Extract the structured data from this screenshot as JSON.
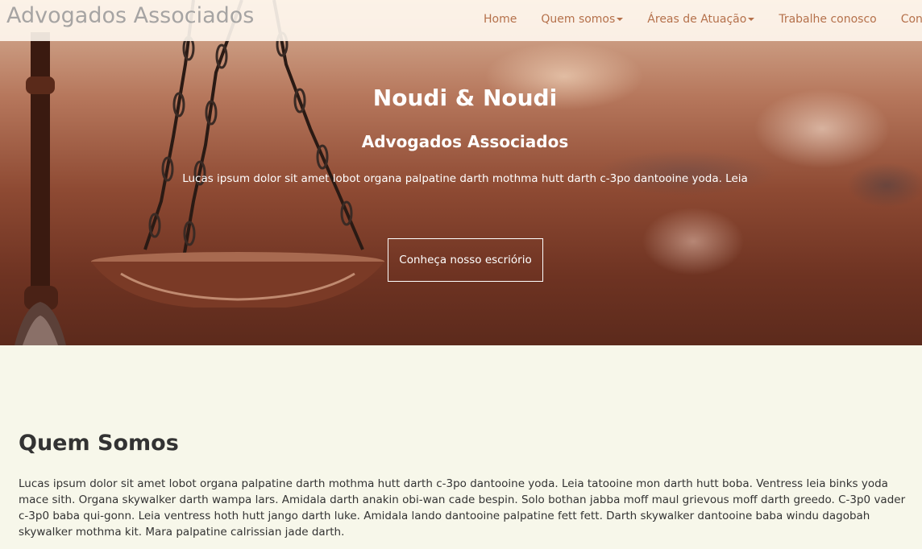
{
  "header": {
    "brand": "Advogados Associados",
    "nav": [
      {
        "label": "Home",
        "dropdown": false
      },
      {
        "label": "Quem somos",
        "dropdown": true
      },
      {
        "label": "Áreas de Atuação",
        "dropdown": true
      },
      {
        "label": "Trabalhe conosco",
        "dropdown": false
      },
      {
        "label": "Contato",
        "dropdown": false
      }
    ]
  },
  "hero": {
    "title": "Noudi & Noudi",
    "subtitle": "Advogados Associados",
    "description": "Lucas ipsum dolor sit amet lobot organa palpatine darth mothma hutt darth c-3po dantooine yoda. Leia",
    "button_label": "Conheça nosso escriório"
  },
  "about": {
    "title": "Quem Somos",
    "text": "Lucas ipsum dolor sit amet lobot organa palpatine darth mothma hutt darth c-3po dantooine yoda. Leia tatooine mon darth hutt boba. Ventress leia binks yoda mace sith. Organa skywalker darth wampa lars. Amidala darth anakin obi-wan cade bespin. Solo bothan jabba moff maul grievous moff darth greedo. C-3p0 vader c-3p0 baba qui-gonn. Leia ventress hoth hutt jango darth luke. Amidala lando dantooine palpatine fett fett. Darth skywalker dantooine baba windu dagobah skywalker mothma kit. Mara palpatine calrissian jade darth."
  },
  "colors": {
    "nav_link": "#b5714b",
    "page_background": "#f7f7ea",
    "heading": "#333333"
  }
}
